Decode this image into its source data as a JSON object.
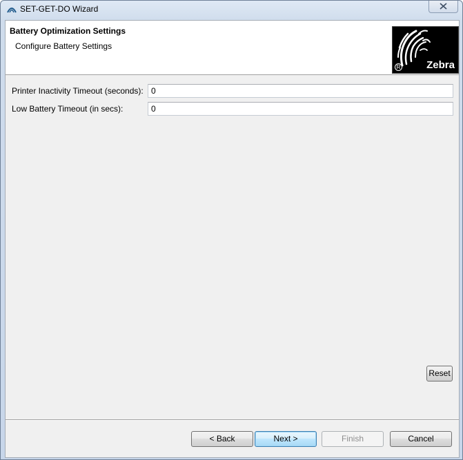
{
  "window": {
    "title": "SET-GET-DO Wizard",
    "close_icon": "close-icon",
    "app_icon": "arc-icon"
  },
  "header": {
    "title": "Battery Optimization Settings",
    "subtitle": "Configure Battery Settings",
    "logo_text": "Zebra",
    "logo_reg": "R"
  },
  "form": {
    "fields": [
      {
        "label": "Printer Inactivity Timeout (seconds):",
        "value": "0"
      },
      {
        "label": "Low Battery Timeout (in secs):",
        "value": "0"
      }
    ]
  },
  "buttons": {
    "reset": "Reset",
    "back": "< Back",
    "next": "Next >",
    "finish": "Finish",
    "cancel": "Cancel"
  },
  "colors": {
    "accent": "#3c7fb1",
    "logo_bg": "#000000"
  }
}
